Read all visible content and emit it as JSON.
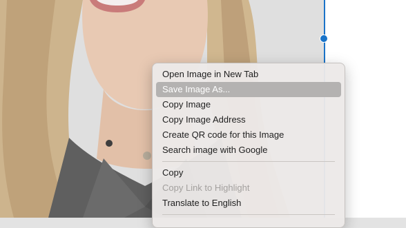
{
  "context_menu": {
    "items": [
      {
        "label": "Open Image in New Tab",
        "state": "normal"
      },
      {
        "label": "Save Image As...",
        "state": "highlighted"
      },
      {
        "label": "Copy Image",
        "state": "normal"
      },
      {
        "label": "Copy Image Address",
        "state": "normal"
      },
      {
        "label": "Create QR code for this Image",
        "state": "normal"
      },
      {
        "label": "Search image with Google",
        "state": "normal"
      }
    ],
    "items_group2": [
      {
        "label": "Copy",
        "state": "normal"
      },
      {
        "label": "Copy Link to Highlight",
        "state": "disabled"
      },
      {
        "label": "Translate to English",
        "state": "normal"
      }
    ]
  },
  "colors": {
    "selection_handle": "#1a73c8",
    "menu_highlight": "#b4b2b1"
  }
}
